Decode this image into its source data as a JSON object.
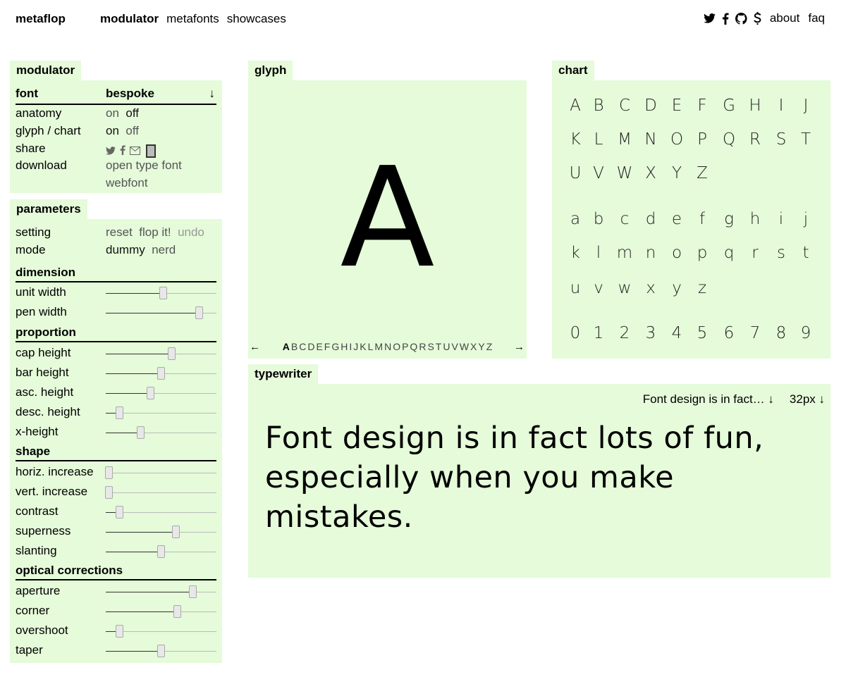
{
  "brand": "metaflop",
  "nav": {
    "modulator": "modulator",
    "metafonts": "metafonts",
    "showcases": "showcases"
  },
  "topnav": {
    "about": "about",
    "faq": "faq",
    "icons": [
      "twitter-icon",
      "facebook-icon",
      "github-icon",
      "dollar-icon"
    ]
  },
  "modulator": {
    "title": "modulator",
    "font_label": "font",
    "font_value": "bespoke",
    "font_arrow": "↓",
    "anatomy_label": "anatomy",
    "anatomy_on": "on",
    "anatomy_off": "off",
    "glyph_chart_label": "glyph / chart",
    "glyph_chart_on": "on",
    "glyph_chart_off": "off",
    "share_label": "share",
    "download_label": "download",
    "download_otf": "open type font",
    "download_webfont": "webfont"
  },
  "parameters": {
    "title": "parameters",
    "setting_label": "setting",
    "reset": "reset",
    "flop": "flop it!",
    "undo": "undo",
    "mode_label": "mode",
    "dummy": "dummy",
    "nerd": "nerd",
    "sections": [
      {
        "title": "dimension",
        "sliders": [
          {
            "label": "unit width",
            "value": 0.52
          },
          {
            "label": "pen width",
            "value": 0.85
          }
        ]
      },
      {
        "title": "proportion",
        "sliders": [
          {
            "label": "cap height",
            "value": 0.6
          },
          {
            "label": "bar height",
            "value": 0.5
          },
          {
            "label": "asc. height",
            "value": 0.41
          },
          {
            "label": "desc. height",
            "value": 0.13
          },
          {
            "label": "x-height",
            "value": 0.32
          }
        ]
      },
      {
        "title": "shape",
        "sliders": [
          {
            "label": "horiz. increase",
            "value": 0.03
          },
          {
            "label": "vert. increase",
            "value": 0.03
          },
          {
            "label": "contrast",
            "value": 0.13
          },
          {
            "label": "superness",
            "value": 0.64
          },
          {
            "label": "slanting",
            "value": 0.5
          }
        ]
      },
      {
        "title": "optical corrections",
        "sliders": [
          {
            "label": "aperture",
            "value": 0.79
          },
          {
            "label": "corner",
            "value": 0.65
          },
          {
            "label": "overshoot",
            "value": 0.13
          },
          {
            "label": "taper",
            "value": 0.5
          }
        ]
      }
    ]
  },
  "glyph": {
    "title": "glyph",
    "current": "A",
    "prev_arrow": "←",
    "next_arrow": "→",
    "letters": [
      "A",
      "B",
      "C",
      "D",
      "E",
      "F",
      "G",
      "H",
      "I",
      "J",
      "K",
      "L",
      "M",
      "N",
      "O",
      "P",
      "Q",
      "R",
      "S",
      "T",
      "U",
      "V",
      "W",
      "X",
      "Y",
      "Z"
    ]
  },
  "chart": {
    "title": "chart",
    "upper": [
      [
        "A",
        "B",
        "C",
        "D",
        "E",
        "F",
        "G",
        "H",
        "I",
        "J"
      ],
      [
        "K",
        "L",
        "M",
        "N",
        "O",
        "P",
        "Q",
        "R",
        "S",
        "T"
      ],
      [
        "U",
        "V",
        "W",
        "X",
        "Y",
        "Z"
      ]
    ],
    "lower": [
      [
        "a",
        "b",
        "c",
        "d",
        "e",
        "f",
        "g",
        "h",
        "i",
        "j"
      ],
      [
        "k",
        "l",
        "m",
        "n",
        "o",
        "p",
        "q",
        "r",
        "s",
        "t"
      ],
      [
        "u",
        "v",
        "w",
        "x",
        "y",
        "z"
      ]
    ],
    "digits": [
      [
        "0",
        "1",
        "2",
        "3",
        "4",
        "5",
        "6",
        "7",
        "8",
        "9"
      ]
    ]
  },
  "typewriter": {
    "title": "typewriter",
    "preset": "Font design is in fact… ↓",
    "size": "32px  ↓",
    "line1": "Font design is in fact lots of fun,",
    "line2": "especially when you make mistakes."
  }
}
